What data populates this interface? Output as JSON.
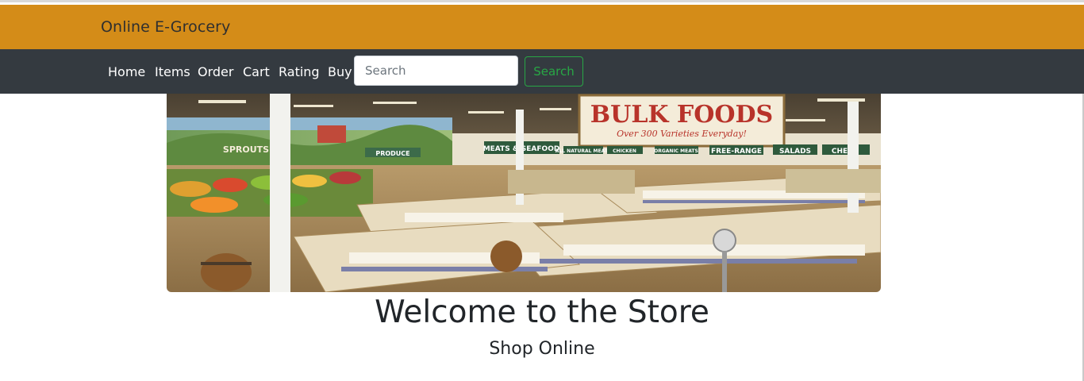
{
  "brand": {
    "title": "Online E-Grocery",
    "bar_color": "#d48c18"
  },
  "nav": {
    "background": "#343a40",
    "items": [
      {
        "label": "Home"
      },
      {
        "label": "Items"
      },
      {
        "label": "Order"
      },
      {
        "label": "Cart"
      },
      {
        "label": "Rating"
      },
      {
        "label": "Buy"
      }
    ],
    "search": {
      "placeholder": "Search",
      "value": "",
      "button_label": "Search",
      "button_color": "#28a745"
    }
  },
  "hero": {
    "image": "grocery-store-interior-photo",
    "signs": {
      "bulk_title": "BULK FOODS",
      "bulk_subtitle": "Over 300 Varieties Everyday!",
      "sign_meats": "MEATS & SEAFOOD",
      "sign_natural": "ALL NATURAL MEATS",
      "sign_chicken": "CHICKEN",
      "sign_organic": "ORGANIC MEATS",
      "sign_free_range": "FREE-RANGE",
      "sign_salads": "SALADS",
      "sign_cheese": "CHE",
      "sign_produce": "PRODUCE",
      "sign_sprouts": "SPROUTS"
    }
  },
  "main": {
    "title": "Welcome to the Store",
    "subtitle": "Shop Online"
  }
}
